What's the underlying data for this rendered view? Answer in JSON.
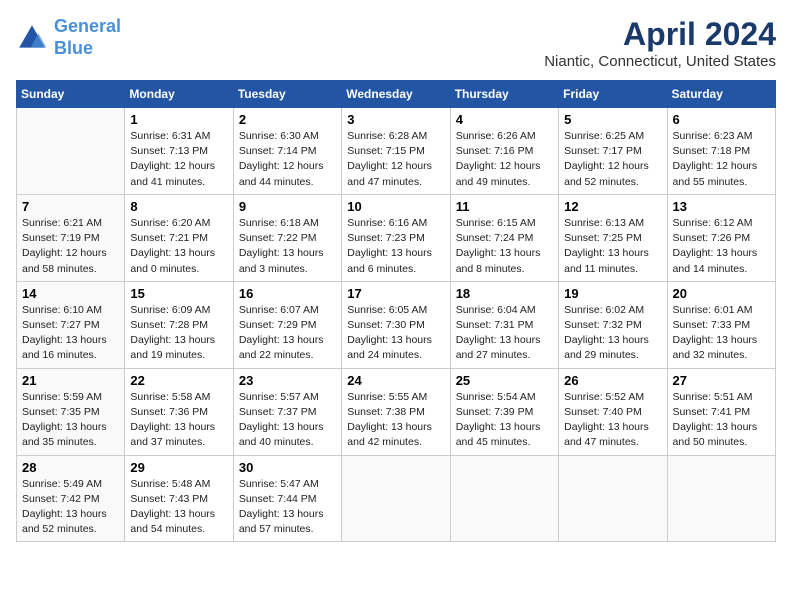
{
  "logo": {
    "line1": "General",
    "line2": "Blue"
  },
  "title": "April 2024",
  "location": "Niantic, Connecticut, United States",
  "days_of_week": [
    "Sunday",
    "Monday",
    "Tuesday",
    "Wednesday",
    "Thursday",
    "Friday",
    "Saturday"
  ],
  "weeks": [
    [
      {
        "day": "",
        "sunrise": "",
        "sunset": "",
        "daylight": ""
      },
      {
        "day": "1",
        "sunrise": "Sunrise: 6:31 AM",
        "sunset": "Sunset: 7:13 PM",
        "daylight": "Daylight: 12 hours and 41 minutes."
      },
      {
        "day": "2",
        "sunrise": "Sunrise: 6:30 AM",
        "sunset": "Sunset: 7:14 PM",
        "daylight": "Daylight: 12 hours and 44 minutes."
      },
      {
        "day": "3",
        "sunrise": "Sunrise: 6:28 AM",
        "sunset": "Sunset: 7:15 PM",
        "daylight": "Daylight: 12 hours and 47 minutes."
      },
      {
        "day": "4",
        "sunrise": "Sunrise: 6:26 AM",
        "sunset": "Sunset: 7:16 PM",
        "daylight": "Daylight: 12 hours and 49 minutes."
      },
      {
        "day": "5",
        "sunrise": "Sunrise: 6:25 AM",
        "sunset": "Sunset: 7:17 PM",
        "daylight": "Daylight: 12 hours and 52 minutes."
      },
      {
        "day": "6",
        "sunrise": "Sunrise: 6:23 AM",
        "sunset": "Sunset: 7:18 PM",
        "daylight": "Daylight: 12 hours and 55 minutes."
      }
    ],
    [
      {
        "day": "7",
        "sunrise": "Sunrise: 6:21 AM",
        "sunset": "Sunset: 7:19 PM",
        "daylight": "Daylight: 12 hours and 58 minutes."
      },
      {
        "day": "8",
        "sunrise": "Sunrise: 6:20 AM",
        "sunset": "Sunset: 7:21 PM",
        "daylight": "Daylight: 13 hours and 0 minutes."
      },
      {
        "day": "9",
        "sunrise": "Sunrise: 6:18 AM",
        "sunset": "Sunset: 7:22 PM",
        "daylight": "Daylight: 13 hours and 3 minutes."
      },
      {
        "day": "10",
        "sunrise": "Sunrise: 6:16 AM",
        "sunset": "Sunset: 7:23 PM",
        "daylight": "Daylight: 13 hours and 6 minutes."
      },
      {
        "day": "11",
        "sunrise": "Sunrise: 6:15 AM",
        "sunset": "Sunset: 7:24 PM",
        "daylight": "Daylight: 13 hours and 8 minutes."
      },
      {
        "day": "12",
        "sunrise": "Sunrise: 6:13 AM",
        "sunset": "Sunset: 7:25 PM",
        "daylight": "Daylight: 13 hours and 11 minutes."
      },
      {
        "day": "13",
        "sunrise": "Sunrise: 6:12 AM",
        "sunset": "Sunset: 7:26 PM",
        "daylight": "Daylight: 13 hours and 14 minutes."
      }
    ],
    [
      {
        "day": "14",
        "sunrise": "Sunrise: 6:10 AM",
        "sunset": "Sunset: 7:27 PM",
        "daylight": "Daylight: 13 hours and 16 minutes."
      },
      {
        "day": "15",
        "sunrise": "Sunrise: 6:09 AM",
        "sunset": "Sunset: 7:28 PM",
        "daylight": "Daylight: 13 hours and 19 minutes."
      },
      {
        "day": "16",
        "sunrise": "Sunrise: 6:07 AM",
        "sunset": "Sunset: 7:29 PM",
        "daylight": "Daylight: 13 hours and 22 minutes."
      },
      {
        "day": "17",
        "sunrise": "Sunrise: 6:05 AM",
        "sunset": "Sunset: 7:30 PM",
        "daylight": "Daylight: 13 hours and 24 minutes."
      },
      {
        "day": "18",
        "sunrise": "Sunrise: 6:04 AM",
        "sunset": "Sunset: 7:31 PM",
        "daylight": "Daylight: 13 hours and 27 minutes."
      },
      {
        "day": "19",
        "sunrise": "Sunrise: 6:02 AM",
        "sunset": "Sunset: 7:32 PM",
        "daylight": "Daylight: 13 hours and 29 minutes."
      },
      {
        "day": "20",
        "sunrise": "Sunrise: 6:01 AM",
        "sunset": "Sunset: 7:33 PM",
        "daylight": "Daylight: 13 hours and 32 minutes."
      }
    ],
    [
      {
        "day": "21",
        "sunrise": "Sunrise: 5:59 AM",
        "sunset": "Sunset: 7:35 PM",
        "daylight": "Daylight: 13 hours and 35 minutes."
      },
      {
        "day": "22",
        "sunrise": "Sunrise: 5:58 AM",
        "sunset": "Sunset: 7:36 PM",
        "daylight": "Daylight: 13 hours and 37 minutes."
      },
      {
        "day": "23",
        "sunrise": "Sunrise: 5:57 AM",
        "sunset": "Sunset: 7:37 PM",
        "daylight": "Daylight: 13 hours and 40 minutes."
      },
      {
        "day": "24",
        "sunrise": "Sunrise: 5:55 AM",
        "sunset": "Sunset: 7:38 PM",
        "daylight": "Daylight: 13 hours and 42 minutes."
      },
      {
        "day": "25",
        "sunrise": "Sunrise: 5:54 AM",
        "sunset": "Sunset: 7:39 PM",
        "daylight": "Daylight: 13 hours and 45 minutes."
      },
      {
        "day": "26",
        "sunrise": "Sunrise: 5:52 AM",
        "sunset": "Sunset: 7:40 PM",
        "daylight": "Daylight: 13 hours and 47 minutes."
      },
      {
        "day": "27",
        "sunrise": "Sunrise: 5:51 AM",
        "sunset": "Sunset: 7:41 PM",
        "daylight": "Daylight: 13 hours and 50 minutes."
      }
    ],
    [
      {
        "day": "28",
        "sunrise": "Sunrise: 5:49 AM",
        "sunset": "Sunset: 7:42 PM",
        "daylight": "Daylight: 13 hours and 52 minutes."
      },
      {
        "day": "29",
        "sunrise": "Sunrise: 5:48 AM",
        "sunset": "Sunset: 7:43 PM",
        "daylight": "Daylight: 13 hours and 54 minutes."
      },
      {
        "day": "30",
        "sunrise": "Sunrise: 5:47 AM",
        "sunset": "Sunset: 7:44 PM",
        "daylight": "Daylight: 13 hours and 57 minutes."
      },
      {
        "day": "",
        "sunrise": "",
        "sunset": "",
        "daylight": ""
      },
      {
        "day": "",
        "sunrise": "",
        "sunset": "",
        "daylight": ""
      },
      {
        "day": "",
        "sunrise": "",
        "sunset": "",
        "daylight": ""
      },
      {
        "day": "",
        "sunrise": "",
        "sunset": "",
        "daylight": ""
      }
    ]
  ]
}
